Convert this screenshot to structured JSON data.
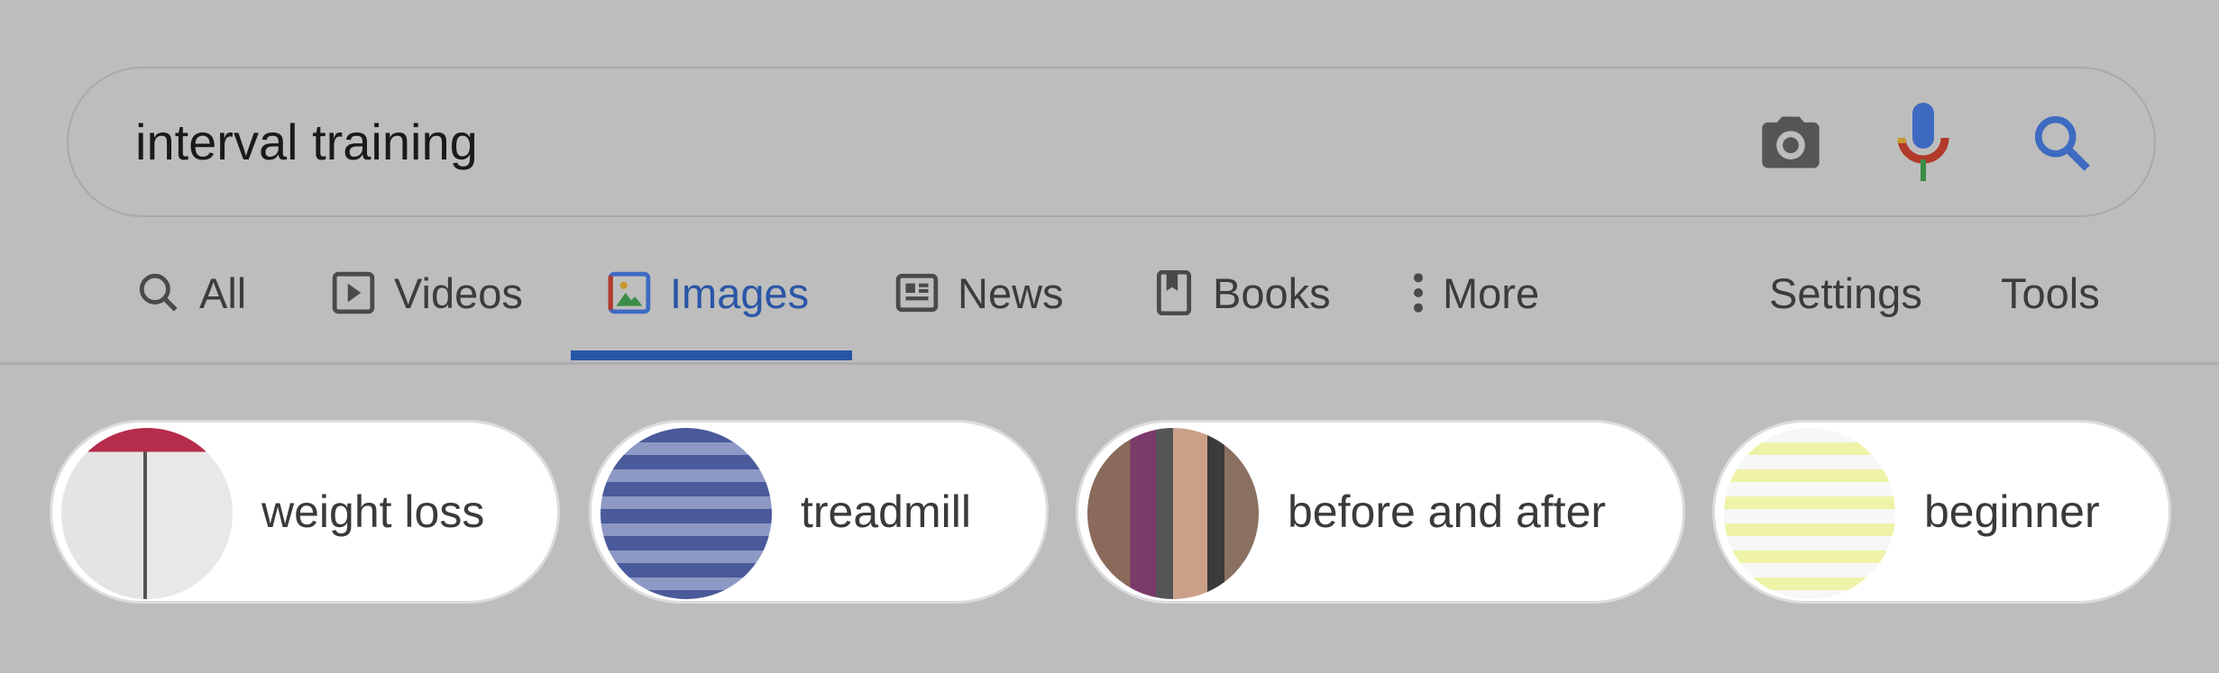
{
  "search": {
    "query": "interval training",
    "icons": [
      "camera-icon",
      "microphone-icon",
      "search-icon"
    ]
  },
  "tabs": [
    {
      "label": "All",
      "icon": "search-icon"
    },
    {
      "label": "Videos",
      "icon": "play-icon"
    },
    {
      "label": "Images",
      "icon": "image-icon",
      "active": true
    },
    {
      "label": "News",
      "icon": "news-icon"
    },
    {
      "label": "Books",
      "icon": "book-icon"
    },
    {
      "label": "More",
      "icon": "more-vert-icon"
    }
  ],
  "tools": {
    "settings": "Settings",
    "tools": "Tools"
  },
  "chips": [
    {
      "label": "weight loss"
    },
    {
      "label": "treadmill"
    },
    {
      "label": "before and after"
    },
    {
      "label": "beginner"
    }
  ],
  "colors": {
    "accent": "#2556a6",
    "background": "#bdbdbd"
  }
}
